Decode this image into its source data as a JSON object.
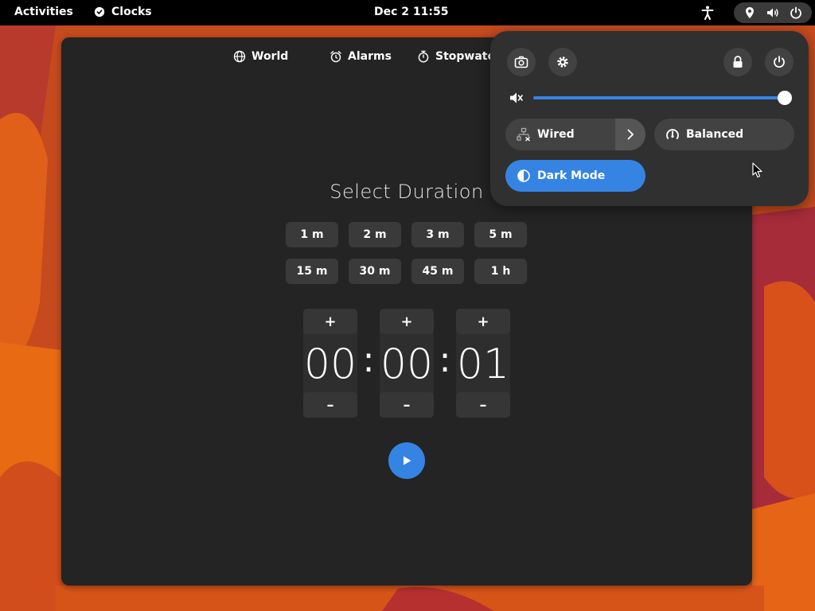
{
  "topbar": {
    "activities": "Activities",
    "app_name": "Clocks",
    "clock": "Dec 2  11:55"
  },
  "clocks": {
    "tabs": [
      {
        "label": "World",
        "icon": "globe-icon"
      },
      {
        "label": "Alarms",
        "icon": "alarm-icon"
      },
      {
        "label": "Stopwatch",
        "icon": "stopwatch-icon"
      }
    ],
    "title": "Select Duration",
    "presets": [
      "1 m",
      "2 m",
      "3 m",
      "5 m",
      "15 m",
      "30 m",
      "45 m",
      "1 h"
    ],
    "spinner": {
      "plus": "+",
      "minus": "–",
      "separator": ":",
      "hours": "00",
      "minutes": "00",
      "seconds": "01"
    }
  },
  "quick_settings": {
    "volume_level": 1.0,
    "wired": "Wired",
    "power_mode": "Balanced",
    "dark_mode": "Dark Mode"
  },
  "colors": {
    "accent": "#3584e4",
    "window_bg": "#242424",
    "panel_bg": "#303030"
  }
}
